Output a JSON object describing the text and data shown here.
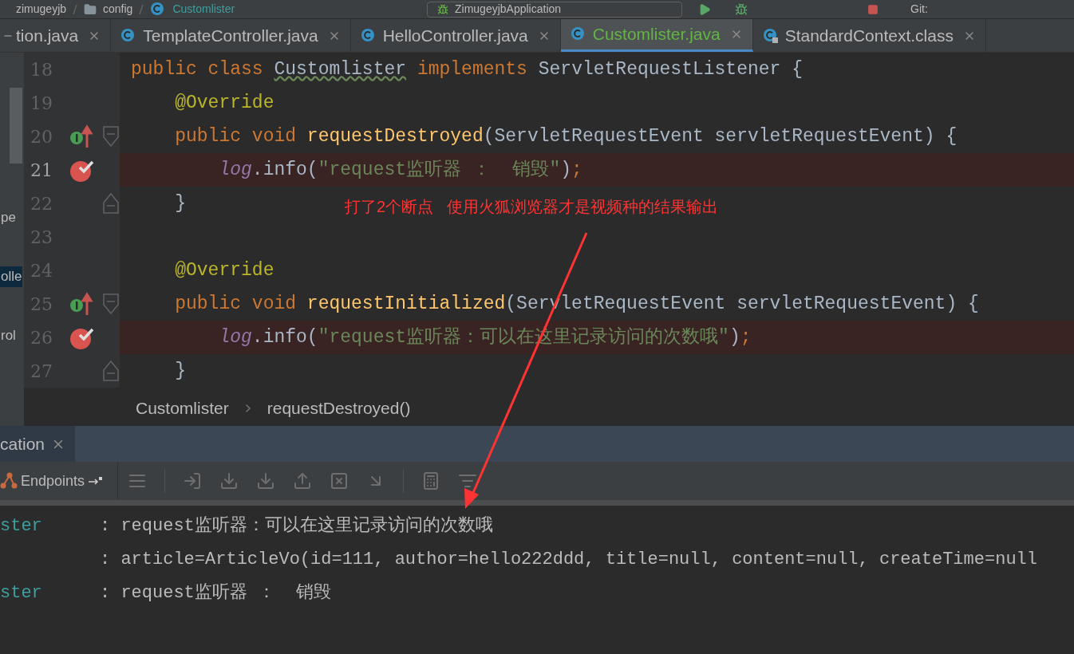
{
  "top_bar": {
    "path": [
      {
        "label": "zimugeyjb",
        "kind": "project"
      },
      {
        "label": "config",
        "kind": "folder"
      },
      {
        "label": "Customlister",
        "kind": "class"
      }
    ],
    "run_config": "ZimugeyjbApplication",
    "git": "Git:"
  },
  "tabs": [
    {
      "label": "tion.java",
      "selected": false,
      "vcs_added": false
    },
    {
      "label": "TemplateController.java",
      "selected": false,
      "kind": "java",
      "vcs_added": false
    },
    {
      "label": "HelloController.java",
      "selected": false,
      "kind": "java",
      "vcs_added": false
    },
    {
      "label": "Customlister.java",
      "selected": true,
      "kind": "java",
      "vcs_added": true
    },
    {
      "label": "StandardContext.class",
      "selected": false,
      "kind": "class",
      "vcs_added": false
    }
  ],
  "side_panel": {
    "items": [
      {
        "label": "pe",
        "selected": false
      },
      {
        "label": "olle",
        "selected": true
      },
      {
        "label": "rol",
        "selected": false
      }
    ]
  },
  "editor": {
    "lines": [
      {
        "number": "18",
        "current": false,
        "breakpoint": false,
        "implements": false,
        "fold_start": false,
        "fold_end": false,
        "tokens": [
          {
            "text": "public class ",
            "kind": "keyword"
          },
          {
            "text": "Customlister",
            "kind": "declaration"
          },
          {
            "text": " implements ",
            "kind": "keyword"
          },
          {
            "text": "ServletRequestListener {",
            "kind": "plain"
          }
        ]
      },
      {
        "number": "19",
        "current": false,
        "breakpoint": false,
        "implements": false,
        "fold_start": false,
        "fold_end": false,
        "tokens": [
          {
            "text": "    @Override",
            "kind": "annotation"
          }
        ]
      },
      {
        "number": "20",
        "current": false,
        "breakpoint": false,
        "implements": true,
        "fold_start": true,
        "fold_end": false,
        "tokens": [
          {
            "text": "    public void ",
            "kind": "keyword"
          },
          {
            "text": "requestDestroyed",
            "kind": "method"
          },
          {
            "text": "(ServletRequestEvent servletRequestEvent) {",
            "kind": "plain"
          }
        ]
      },
      {
        "number": "21",
        "current": true,
        "breakpoint": true,
        "implements": false,
        "fold_start": false,
        "fold_end": false,
        "tokens": [
          {
            "text": "        log",
            "kind": "field"
          },
          {
            "text": ".info(",
            "kind": "plain"
          },
          {
            "text": "\"request监听器 ：  销毁\"",
            "kind": "string"
          },
          {
            "text": ")",
            "kind": "plain"
          },
          {
            "text": ";",
            "kind": "keyword"
          }
        ]
      },
      {
        "number": "22",
        "current": false,
        "breakpoint": false,
        "implements": false,
        "fold_start": false,
        "fold_end": true,
        "tokens": [
          {
            "text": "    }",
            "kind": "plain"
          }
        ]
      },
      {
        "number": "23",
        "current": false,
        "breakpoint": false,
        "implements": false,
        "fold_start": false,
        "fold_end": false
      },
      {
        "number": "24",
        "current": false,
        "breakpoint": false,
        "implements": false,
        "fold_start": false,
        "fold_end": false,
        "tokens": [
          {
            "text": "    @Override",
            "kind": "annotation"
          }
        ]
      },
      {
        "number": "25",
        "current": false,
        "breakpoint": false,
        "implements": true,
        "fold_start": true,
        "fold_end": false,
        "tokens": [
          {
            "text": "    public void ",
            "kind": "keyword"
          },
          {
            "text": "requestInitialized",
            "kind": "method"
          },
          {
            "text": "(ServletRequestEvent servletRequestEvent) {",
            "kind": "plain"
          }
        ]
      },
      {
        "number": "26",
        "current": false,
        "breakpoint": true,
        "implements": false,
        "fold_start": false,
        "fold_end": false,
        "tokens": [
          {
            "text": "        log",
            "kind": "field"
          },
          {
            "text": ".info(",
            "kind": "plain"
          },
          {
            "text": "\"request监听器：可以在这里记录访问的次数哦\"",
            "kind": "string"
          },
          {
            "text": ")",
            "kind": "plain"
          },
          {
            "text": ";",
            "kind": "keyword"
          }
        ]
      },
      {
        "number": "27",
        "current": false,
        "breakpoint": false,
        "implements": false,
        "fold_start": false,
        "fold_end": true,
        "tokens": [
          {
            "text": "    }",
            "kind": "plain"
          }
        ]
      }
    ]
  },
  "annotation": {
    "text": "打了2个断点   使用火狐浏览器才是视频种的结果输出"
  },
  "breadcrumb": [
    "Customlister",
    "requestDestroyed()"
  ],
  "run_panel": {
    "tab": "cation",
    "endpoints": "Endpoints"
  },
  "console": {
    "lines": [
      {
        "source": "ster",
        "message": ": request监听器：可以在这里记录访问的次数哦"
      },
      {
        "message": ": article=ArticleVo(id=111, author=hello222ddd, title=null, content=null, createTime=null"
      },
      {
        "source": "ster",
        "message": ": request监听器 ：  销毁"
      }
    ]
  }
}
